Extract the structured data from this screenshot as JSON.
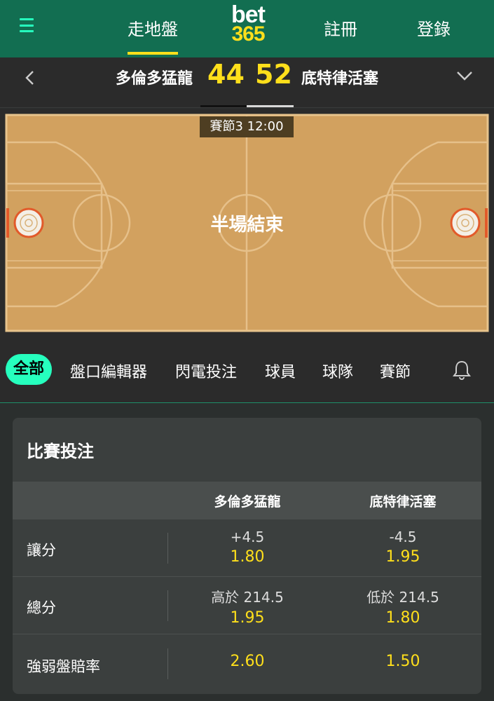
{
  "header": {
    "nav_left": "走地盤",
    "logo_top": "bet",
    "logo_bottom": "365",
    "register": "註冊",
    "login": "登錄"
  },
  "match": {
    "home_team": "多倫多猛龍",
    "away_team": "底特律活塞",
    "home_score": "44",
    "away_score": "52",
    "period_clock": "賽節3  12:00",
    "court_status": "半場結束"
  },
  "tabs": [
    "全部",
    "盤口編輯器",
    "閃電投注",
    "球員",
    "球隊",
    "賽節"
  ],
  "bets": {
    "title": "比賽投注",
    "columns": [
      "多倫多猛龍",
      "底特律活塞"
    ],
    "rows": [
      {
        "label": "讓分",
        "home_line": "+4.5",
        "home_odds": "1.80",
        "away_line": "-4.5",
        "away_odds": "1.95"
      },
      {
        "label": "總分",
        "home_line": "高於 214.5",
        "home_odds": "1.95",
        "away_line": "低於 214.5",
        "away_odds": "1.80"
      },
      {
        "label": "強弱盤賠率",
        "home_odds": "2.60",
        "away_odds": "1.50"
      }
    ]
  },
  "colors": {
    "header_green": "#126e51",
    "accent_yellow": "#ffdf1b",
    "accent_mint": "#26ffbe",
    "court_wood": "#d2a15f"
  }
}
